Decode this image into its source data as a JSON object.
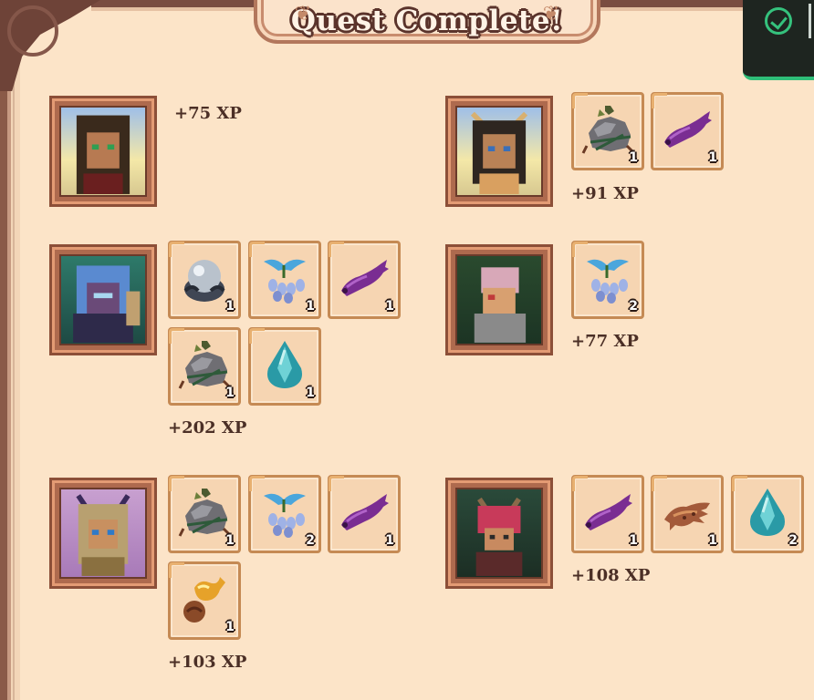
{
  "title": "Quest Complete!",
  "characters": [
    {
      "id": "char1",
      "xp": "+75 XP",
      "items": []
    },
    {
      "id": "char2",
      "xp": "+91 XP",
      "items": [
        {
          "icon": "rock-pile-icon",
          "qty": "1"
        },
        {
          "icon": "purple-fish-icon",
          "qty": "1"
        }
      ]
    },
    {
      "id": "char3",
      "xp": "+202 XP",
      "items": [
        {
          "icon": "silver-orb-icon",
          "qty": "1"
        },
        {
          "icon": "blue-flower-icon",
          "qty": "1"
        },
        {
          "icon": "purple-fish-icon",
          "qty": "1"
        },
        {
          "icon": "rock-pile-icon",
          "qty": "1"
        },
        {
          "icon": "teal-crystal-icon",
          "qty": "1"
        }
      ]
    },
    {
      "id": "char4",
      "xp": "+77 XP",
      "items": [
        {
          "icon": "blue-flower-icon",
          "qty": "2"
        }
      ]
    },
    {
      "id": "char5",
      "xp": "+103 XP",
      "items": [
        {
          "icon": "rock-pile-icon",
          "qty": "1"
        },
        {
          "icon": "blue-flower-icon",
          "qty": "2"
        },
        {
          "icon": "purple-fish-icon",
          "qty": "1"
        },
        {
          "icon": "orange-pouch-icon",
          "qty": "1"
        }
      ]
    },
    {
      "id": "char6",
      "xp": "+108 XP",
      "items": [
        {
          "icon": "purple-fish-icon",
          "qty": "1"
        },
        {
          "icon": "brown-root-icon",
          "qty": "1"
        },
        {
          "icon": "teal-crystal-icon",
          "qty": "2"
        }
      ]
    }
  ],
  "colors": {
    "background": "#fce4c8",
    "frame": "#ae6a4e",
    "toast_accent": "#2fbe78"
  }
}
